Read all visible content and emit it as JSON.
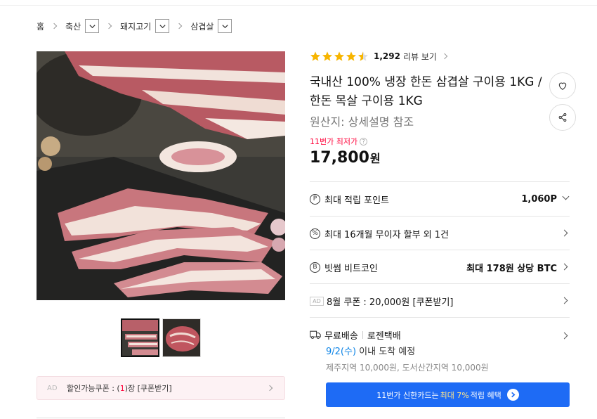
{
  "breadcrumb": {
    "items": [
      "홈",
      "축산",
      "돼지고기",
      "삼겹살"
    ]
  },
  "gallery": {
    "main_image": "pork-belly-photo",
    "thumbnails": [
      "pork-belly-thumb",
      "pork-neck-thumb"
    ]
  },
  "ad_coupon": {
    "ad_label": "AD",
    "text_before": "할인가능쿠폰 : (",
    "count": "1",
    "text_after": ")장 [쿠폰받기]"
  },
  "rating": {
    "stars": 4.5,
    "count": "1,292",
    "review_label": "리뷰 보기"
  },
  "product": {
    "title": "국내산 100% 냉장 한돈 삼겹살 구이용 1KG / 한돈 목살 구이용 1KG",
    "origin": "원산지: 상세설명 참조",
    "lowest_label": "11번가 최저가",
    "price": "17,800",
    "price_unit": "원"
  },
  "benefits": {
    "points_icon": "P",
    "points_label": "최대 적립 포인트",
    "points_value": "1,060P",
    "installment_icon": "%",
    "installment_label": "최대 16개월 무이자 할부 외 1건",
    "bitcoin_icon": "B",
    "bitcoin_label": "빗썸 비트코인",
    "bitcoin_value": "최대 178원 상당 BTC",
    "coupon_ad": "AD",
    "coupon_label": "8월 쿠폰 : 20,000원 [쿠폰받기]"
  },
  "delivery": {
    "free_label": "무료배송",
    "carrier": "로젠택배",
    "date": "9/2(수)",
    "eta_suffix": "이내 도착 예정",
    "extra_fee": "제주지역 10,000원, 도서산간지역 10,000원"
  },
  "card_promo": {
    "prefix": "11번가 신한카드는",
    "highlight": "최대 7%",
    "suffix": "적립 혜택"
  },
  "colors": {
    "accent_red": "#ff0038",
    "accent_blue": "#0b83e6",
    "button_blue": "#1e6bf5",
    "star": "#f7b500"
  }
}
